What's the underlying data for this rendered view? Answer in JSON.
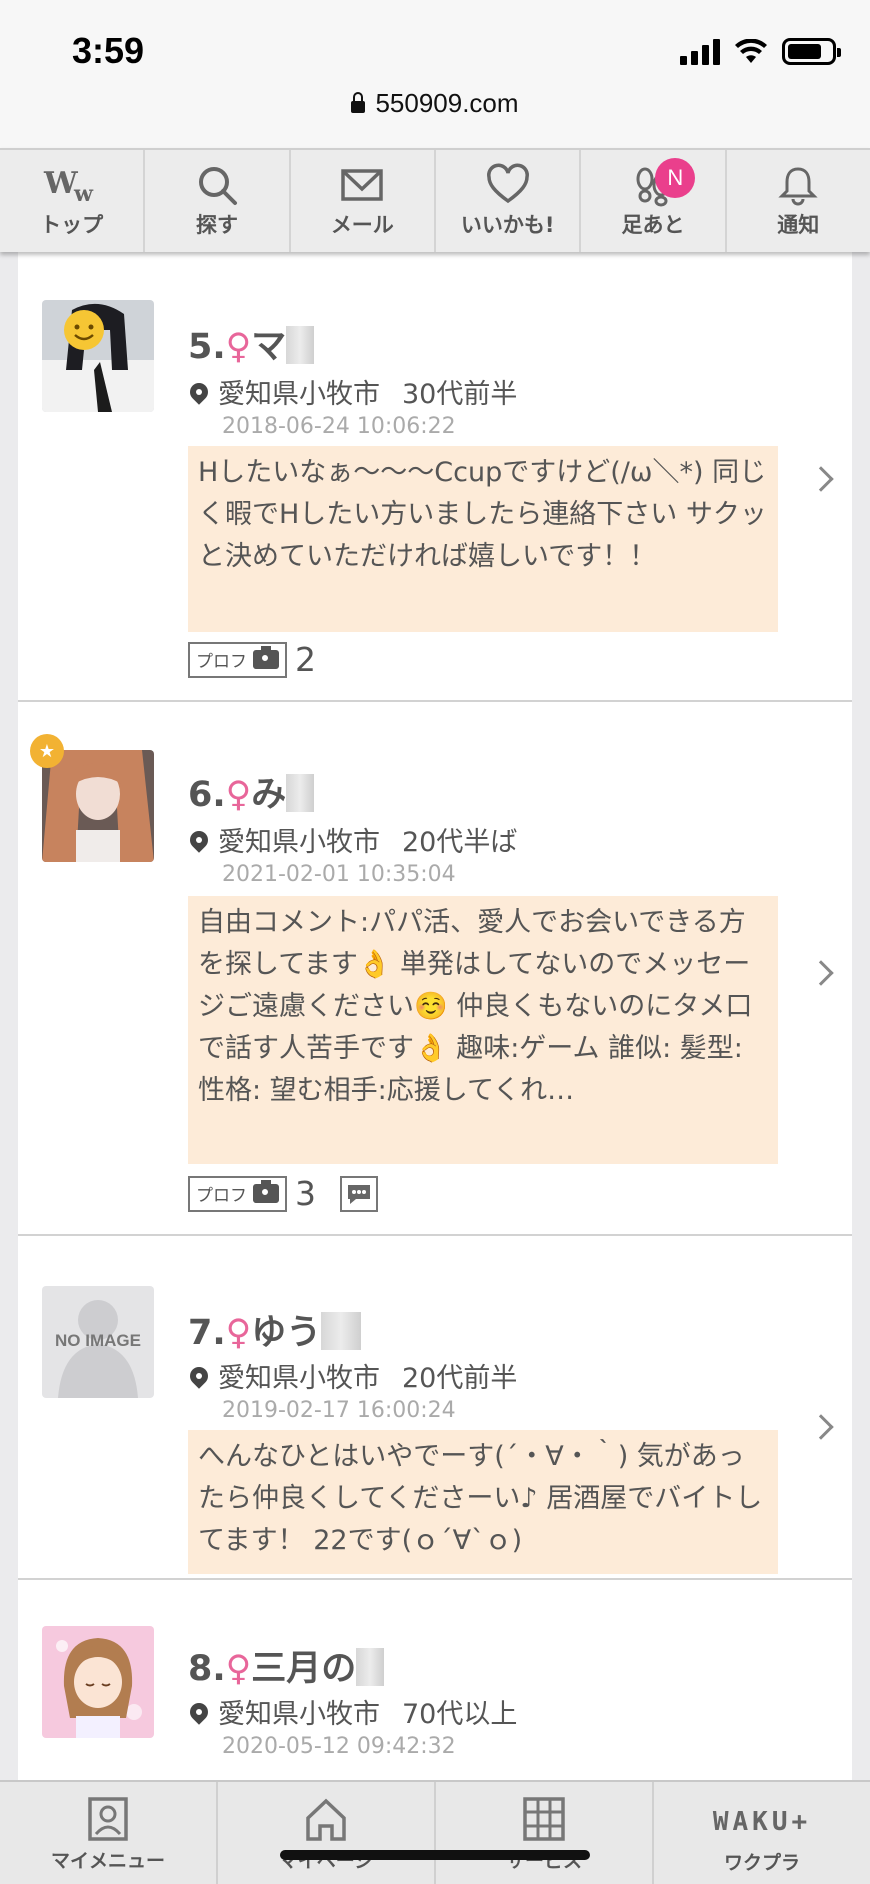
{
  "status_bar": {
    "time": "3:59"
  },
  "url_bar": {
    "domain": "550909.com"
  },
  "top_nav": {
    "items": [
      {
        "label": "トップ",
        "icon": "ww-logo-icon"
      },
      {
        "label": "探す",
        "icon": "search-icon"
      },
      {
        "label": "メール",
        "icon": "mail-icon"
      },
      {
        "label": "いいかも!",
        "icon": "heart-icon"
      },
      {
        "label": "足あと",
        "icon": "footprints-icon",
        "badge": "N"
      },
      {
        "label": "通知",
        "icon": "bell-icon"
      }
    ]
  },
  "profiles": [
    {
      "rank": "5.",
      "gender": "♀",
      "name": "マ",
      "location": "愛知県小牧市",
      "age": "30代前半",
      "date": "2018-06-24 10:06:22",
      "comment": "Hしたいなぁ〜〜〜Ccupですけど(/ω＼*) 同じく暇でHしたい方いましたら連絡下さい サクッと決めていただければ嬉しいです！！",
      "prof_label": "プロフ",
      "photo_count": "2"
    },
    {
      "rank": "6.",
      "gender": "♀",
      "name": "み",
      "location": "愛知県小牧市",
      "age": "20代半ば",
      "date": "2021-02-01 10:35:04",
      "comment": "自由コメント:パパ活、愛人でお会いできる方を探してます👌 単発はしてないのでメッセージご遠慮ください☺️ 仲良くもないのにタメ口で話す人苦手です👌 趣味:ゲーム 誰似: 髪型: 性格: 望む相手:応援してくれ…",
      "prof_label": "プロフ",
      "photo_count": "3"
    },
    {
      "rank": "7.",
      "gender": "♀",
      "name": "ゆう",
      "location": "愛知県小牧市",
      "age": "20代前半",
      "date": "2019-02-17 16:00:24",
      "comment": "へんなひとはいやでーす(´・∀・｀) 気があったら仲良くしてくださーい♪ 居酒屋でバイトしてます！ 22です(ｏ´∀`ｏ)",
      "no_image_label": "NO IMAGE"
    },
    {
      "rank": "8.",
      "gender": "♀",
      "name": "三月の",
      "location": "愛知県小牧市",
      "age": "70代以上",
      "date": "2020-05-12 09:42:32"
    }
  ],
  "bottom_nav": {
    "items": [
      {
        "label": "マイメニュー",
        "icon": "profile-card-icon"
      },
      {
        "label": "マイページ",
        "icon": "home-icon"
      },
      {
        "label": "サービス",
        "icon": "grid-icon"
      },
      {
        "label": "ワクプラ",
        "logo": "WAKU+"
      }
    ]
  },
  "colors": {
    "accent_pink": "#e8669a",
    "comment_bg": "#fdebd8",
    "badge_pink": "#ea3f8c"
  }
}
